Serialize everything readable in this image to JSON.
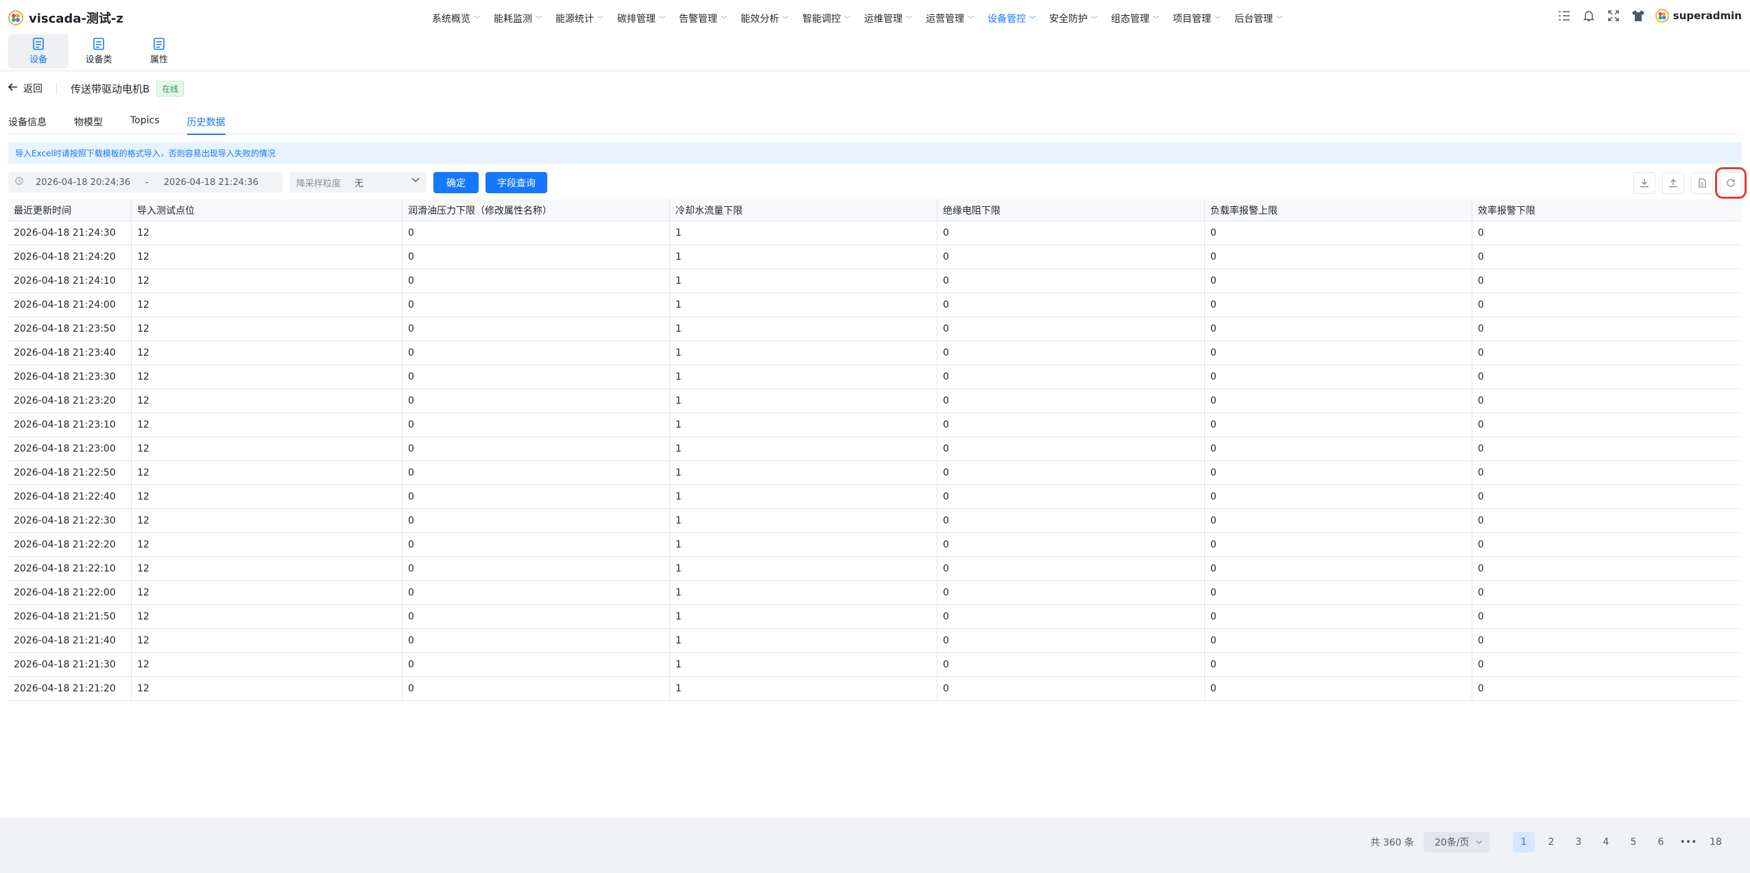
{
  "app": {
    "title": "viscada-测试-z"
  },
  "nav": {
    "items": [
      {
        "label": "系统概览"
      },
      {
        "label": "能耗监测"
      },
      {
        "label": "能源统计"
      },
      {
        "label": "碳排管理"
      },
      {
        "label": "告警管理"
      },
      {
        "label": "能效分析"
      },
      {
        "label": "智能调控"
      },
      {
        "label": "运维管理"
      },
      {
        "label": "运营管理"
      },
      {
        "label": "设备管控",
        "active": true
      },
      {
        "label": "安全防护"
      },
      {
        "label": "组态管理"
      },
      {
        "label": "项目管理"
      },
      {
        "label": "后台管理"
      }
    ]
  },
  "user": {
    "name": "superadmin"
  },
  "subtabs": [
    {
      "label": "设备",
      "active": true
    },
    {
      "label": "设备类"
    },
    {
      "label": "属性"
    }
  ],
  "header": {
    "back_label": "返回",
    "device_name": "传送带驱动电机B",
    "status": "在线"
  },
  "tabs": [
    {
      "label": "设备信息"
    },
    {
      "label": "物模型"
    },
    {
      "label": "Topics"
    },
    {
      "label": "历史数据",
      "active": true
    }
  ],
  "notice": "导入Excel时请按照下载模板的格式导入，否则容易出现导入失败的情况",
  "toolbar": {
    "start_date": "2026-04-18 20:24:36",
    "separator": "-",
    "end_date": "2026-04-18 21:24:36",
    "sampling_label": "降采样粒度",
    "sampling_value": "无",
    "confirm_label": "确定",
    "field_query_label": "字段查询"
  },
  "table": {
    "columns": [
      "最近更新时间",
      "导入测试点位",
      "润滑油压力下限（修改属性名称）",
      "冷却水流量下限",
      "绝缘电阻下限",
      "负载率报警上限",
      "效率报警下限"
    ],
    "rows": [
      [
        "2026-04-18 21:24:30",
        "12",
        "0",
        "1",
        "0",
        "0",
        "0"
      ],
      [
        "2026-04-18 21:24:20",
        "12",
        "0",
        "1",
        "0",
        "0",
        "0"
      ],
      [
        "2026-04-18 21:24:10",
        "12",
        "0",
        "1",
        "0",
        "0",
        "0"
      ],
      [
        "2026-04-18 21:24:00",
        "12",
        "0",
        "1",
        "0",
        "0",
        "0"
      ],
      [
        "2026-04-18 21:23:50",
        "12",
        "0",
        "1",
        "0",
        "0",
        "0"
      ],
      [
        "2026-04-18 21:23:40",
        "12",
        "0",
        "1",
        "0",
        "0",
        "0"
      ],
      [
        "2026-04-18 21:23:30",
        "12",
        "0",
        "1",
        "0",
        "0",
        "0"
      ],
      [
        "2026-04-18 21:23:20",
        "12",
        "0",
        "1",
        "0",
        "0",
        "0"
      ],
      [
        "2026-04-18 21:23:10",
        "12",
        "0",
        "1",
        "0",
        "0",
        "0"
      ],
      [
        "2026-04-18 21:23:00",
        "12",
        "0",
        "1",
        "0",
        "0",
        "0"
      ],
      [
        "2026-04-18 21:22:50",
        "12",
        "0",
        "1",
        "0",
        "0",
        "0"
      ],
      [
        "2026-04-18 21:22:40",
        "12",
        "0",
        "1",
        "0",
        "0",
        "0"
      ],
      [
        "2026-04-18 21:22:30",
        "12",
        "0",
        "1",
        "0",
        "0",
        "0"
      ],
      [
        "2026-04-18 21:22:20",
        "12",
        "0",
        "1",
        "0",
        "0",
        "0"
      ],
      [
        "2026-04-18 21:22:10",
        "12",
        "0",
        "1",
        "0",
        "0",
        "0"
      ],
      [
        "2026-04-18 21:22:00",
        "12",
        "0",
        "1",
        "0",
        "0",
        "0"
      ],
      [
        "2026-04-18 21:21:50",
        "12",
        "0",
        "1",
        "0",
        "0",
        "0"
      ],
      [
        "2026-04-18 21:21:40",
        "12",
        "0",
        "1",
        "0",
        "0",
        "0"
      ],
      [
        "2026-04-18 21:21:30",
        "12",
        "0",
        "1",
        "0",
        "0",
        "0"
      ],
      [
        "2026-04-18 21:21:20",
        "12",
        "0",
        "1",
        "0",
        "0",
        "0"
      ]
    ]
  },
  "pagination": {
    "total_label": "共 360 条",
    "page_size": "20条/页",
    "pages": [
      "1",
      "2",
      "3",
      "4",
      "5",
      "6",
      "•••",
      "18"
    ],
    "current": "1"
  },
  "colors": {
    "accent": "#1677ff",
    "highlight": "#e03c2e",
    "online": "#1f9d55"
  },
  "icons": {
    "toolbar_right": [
      "download-icon",
      "upload-icon",
      "template-file-icon",
      "refresh-icon"
    ],
    "top_right": [
      "task-list-icon",
      "bell-icon",
      "fullscreen-icon",
      "theme-shirt-icon"
    ]
  }
}
